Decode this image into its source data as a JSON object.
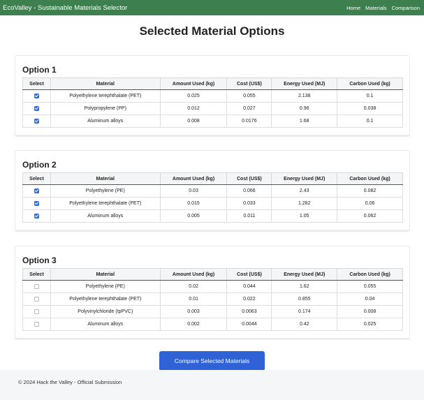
{
  "navbar": {
    "brand": "EcoValley - Sustainable Materials Selector",
    "links": [
      "Home",
      "Materials",
      "Comparison"
    ]
  },
  "page_title": "Selected Material Options",
  "columns": [
    "Select",
    "Material",
    "Amount Used (kg)",
    "Cost (US$)",
    "Energy Used (MJ)",
    "Carbon Used (kg)"
  ],
  "options": [
    {
      "title": "Option 1",
      "rows": [
        {
          "selected": true,
          "material": "Polyethylene terephthalate (PET)",
          "amount": "0.025",
          "cost": "0.055",
          "energy": "2.138",
          "carbon": "0.1"
        },
        {
          "selected": true,
          "material": "Polypropylene (PP)",
          "amount": "0.012",
          "cost": "0.027",
          "energy": "0.96",
          "carbon": "0.038"
        },
        {
          "selected": true,
          "material": "Aluminum alloys",
          "amount": "0.008",
          "cost": "0.0176",
          "energy": "1.68",
          "carbon": "0.1"
        }
      ]
    },
    {
      "title": "Option 2",
      "rows": [
        {
          "selected": true,
          "material": "Polyethylene (PE)",
          "amount": "0.03",
          "cost": "0.066",
          "energy": "2.43",
          "carbon": "0.082"
        },
        {
          "selected": true,
          "material": "Polyethylene terephthalate (PET)",
          "amount": "0.015",
          "cost": "0.033",
          "energy": "1.282",
          "carbon": "0.06"
        },
        {
          "selected": true,
          "material": "Aluminum alloys",
          "amount": "0.005",
          "cost": "0.011",
          "energy": "1.05",
          "carbon": "0.062"
        }
      ]
    },
    {
      "title": "Option 3",
      "rows": [
        {
          "selected": false,
          "material": "Polyethylene (PE)",
          "amount": "0.02",
          "cost": "0.044",
          "energy": "1.62",
          "carbon": "0.055"
        },
        {
          "selected": false,
          "material": "Polyethylene terephthalate (PET)",
          "amount": "0.01",
          "cost": "0.022",
          "energy": "0.855",
          "carbon": "0.04"
        },
        {
          "selected": false,
          "material": "Polyvinylchloride (tpPVC)",
          "amount": "0.003",
          "cost": "0.0063",
          "energy": "0.174",
          "carbon": "0.008"
        },
        {
          "selected": false,
          "material": "Aluminum alloys",
          "amount": "0.002",
          "cost": "0.0044",
          "energy": "0.42",
          "carbon": "0.025"
        }
      ]
    }
  ],
  "compare_button": "Compare Selected Materials",
  "footer": "© 2024 Hack the Valley - Official Submission",
  "colors": {
    "navbar": "#3e7f50",
    "button": "#2f62d6",
    "checkbox": "#2f6fdb"
  }
}
